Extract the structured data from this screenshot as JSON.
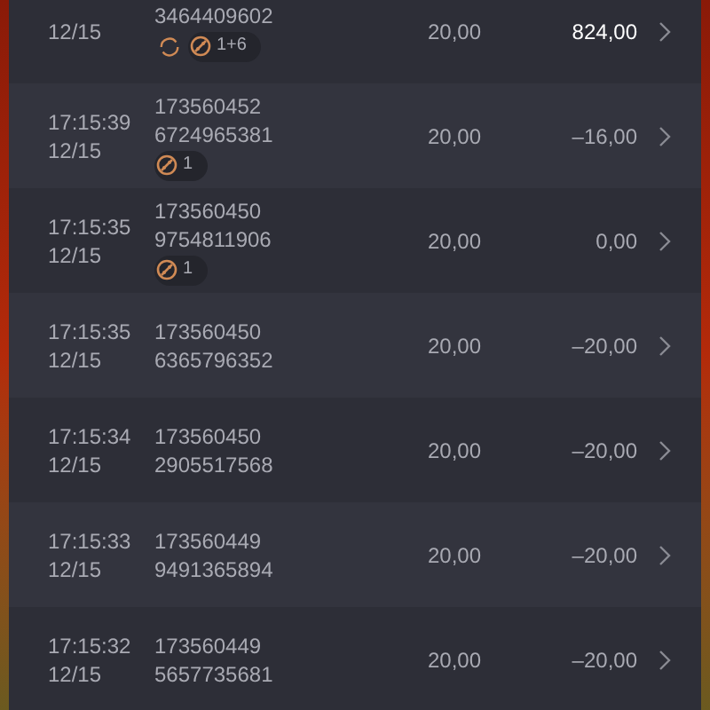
{
  "rows": [
    {
      "date": "12/15",
      "id_lines": [
        "3464409602"
      ],
      "badges": [
        {
          "kind": "refresh"
        },
        {
          "kind": "ball",
          "count": "1+6"
        }
      ],
      "bet": "20,00",
      "result": "824,00",
      "highlighted": true
    },
    {
      "time": "17:15:39",
      "date": "12/15",
      "id_lines": [
        "173560452",
        "6724965381"
      ],
      "badges": [
        {
          "kind": "ball",
          "count": "1"
        }
      ],
      "bet": "20,00",
      "result": "–16,00",
      "highlighted": false
    },
    {
      "time": "17:15:35",
      "date": "12/15",
      "id_lines": [
        "173560450",
        "9754811906"
      ],
      "badges": [
        {
          "kind": "ball",
          "count": "1"
        }
      ],
      "bet": "20,00",
      "result": "0,00",
      "highlighted": false
    },
    {
      "time": "17:15:35",
      "date": "12/15",
      "id_lines": [
        "173560450",
        "6365796352"
      ],
      "bet": "20,00",
      "result": "–20,00",
      "highlighted": false
    },
    {
      "time": "17:15:34",
      "date": "12/15",
      "id_lines": [
        "173560450",
        "2905517568"
      ],
      "bet": "20,00",
      "result": "–20,00",
      "highlighted": false
    },
    {
      "time": "17:15:33",
      "date": "12/15",
      "id_lines": [
        "173560449",
        "9491365894"
      ],
      "bet": "20,00",
      "result": "–20,00",
      "highlighted": false
    },
    {
      "time": "17:15:32",
      "date": "12/15",
      "id_lines": [
        "173560449",
        "5657735681"
      ],
      "bet": "20,00",
      "result": "–20,00",
      "highlighted": false
    }
  ]
}
